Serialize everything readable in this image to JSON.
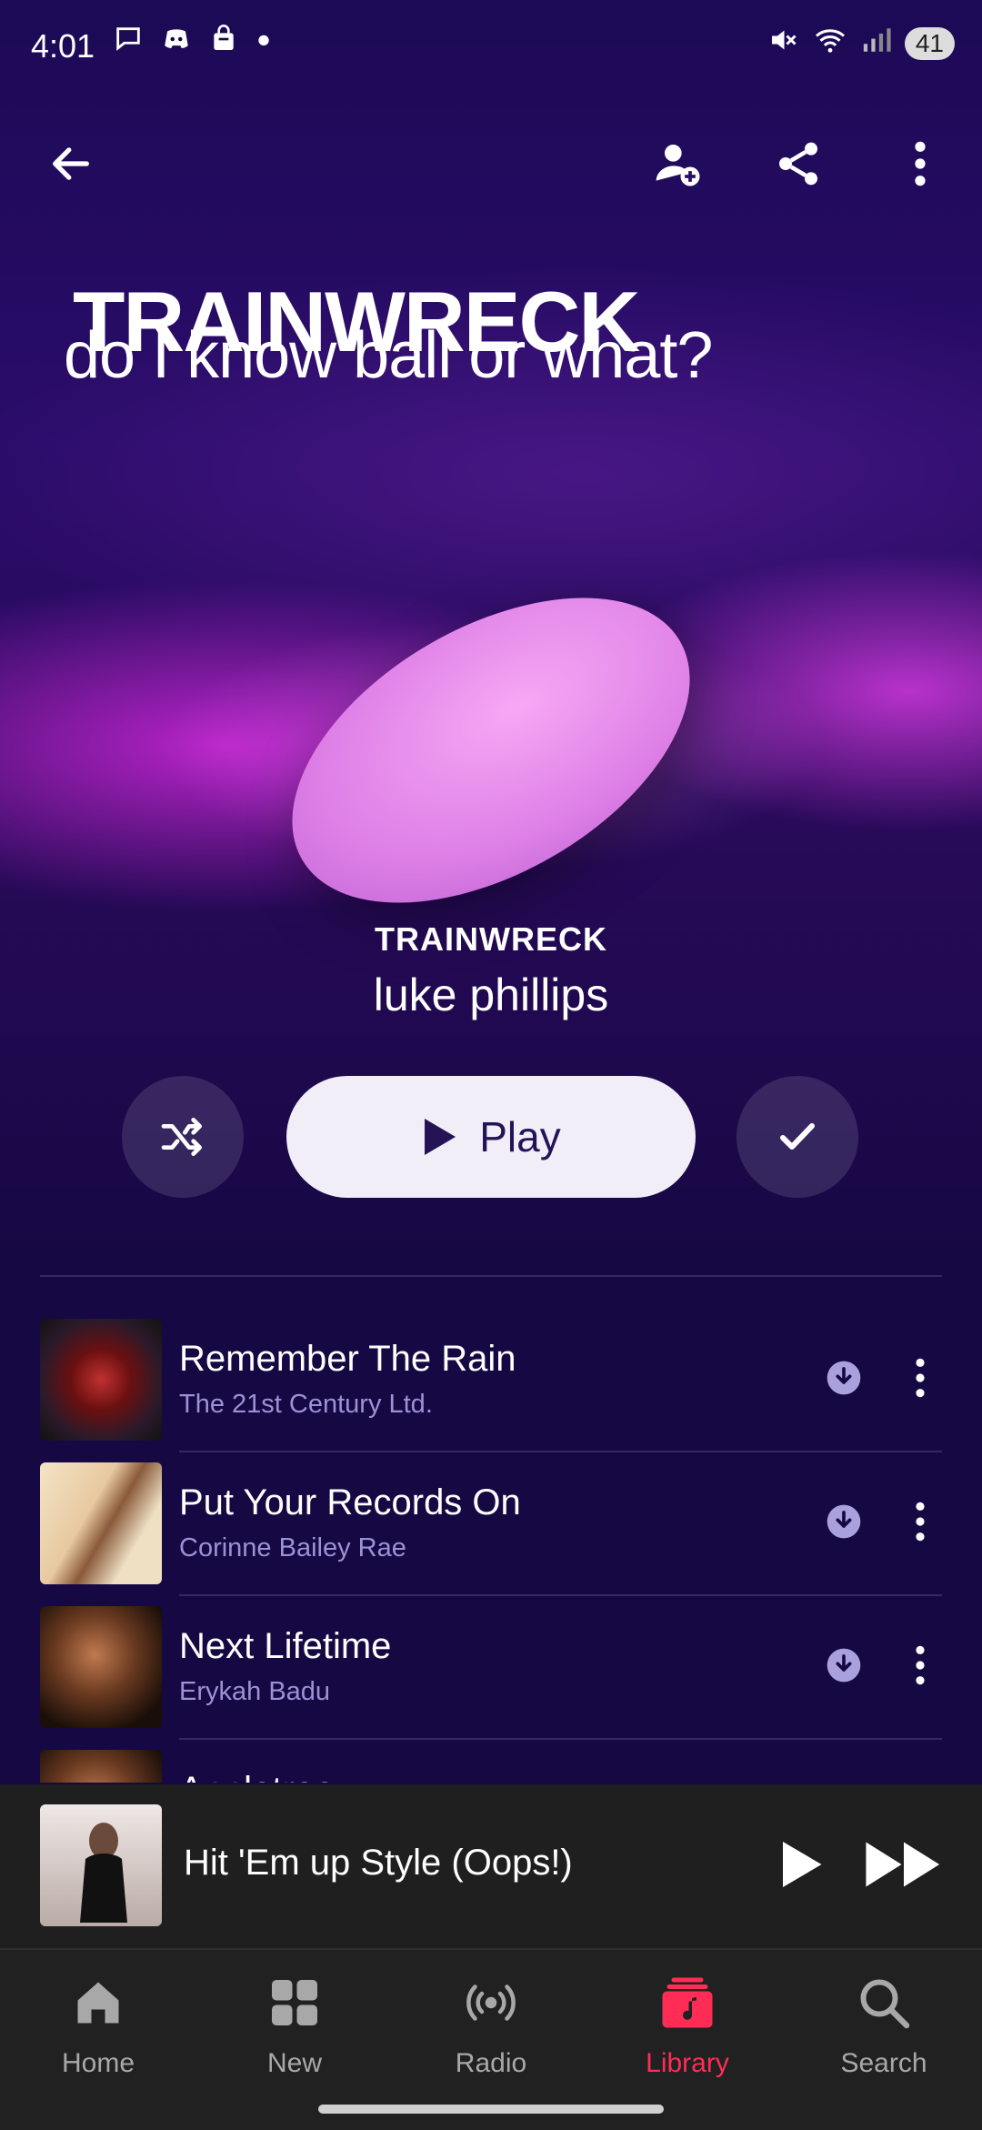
{
  "status_bar": {
    "time": "4:01",
    "battery": "41",
    "left_icons": [
      "chat-icon",
      "discord-icon",
      "shopping-bag-icon",
      "dot-icon"
    ],
    "right_icons": [
      "mute-icon",
      "wifi-icon",
      "signal-icon"
    ]
  },
  "header": {
    "back_icon": "arrow-left-icon",
    "actions": [
      "add-user-icon",
      "share-icon",
      "more-vertical-icon"
    ],
    "title": "TRAINWRECK",
    "subtitle": "do I know ball or what?"
  },
  "album": {
    "title": "TRAINWRECK",
    "artist": "luke phillips"
  },
  "controls": {
    "shuffle_icon": "shuffle-icon",
    "play_label": "Play",
    "added_icon": "checkmark-icon"
  },
  "tracks": [
    {
      "title": "Remember The Rain",
      "artist": "The 21st Century Ltd."
    },
    {
      "title": "Put Your Records On",
      "artist": "Corinne Bailey Rae"
    },
    {
      "title": "Next Lifetime",
      "artist": "Erykah Badu"
    },
    {
      "title": "Appletree",
      "artist": ""
    }
  ],
  "mini_player": {
    "title": "Hit 'Em up Style (Oops!)"
  },
  "tabs": [
    {
      "label": "Home",
      "icon": "home-icon"
    },
    {
      "label": "New",
      "icon": "grid-icon"
    },
    {
      "label": "Radio",
      "icon": "radio-icon"
    },
    {
      "label": "Library",
      "icon": "music-library-icon"
    },
    {
      "label": "Search",
      "icon": "search-icon"
    }
  ],
  "colors": {
    "accent": "#ff2d55",
    "background": "#160843",
    "secondary_text": "#9b92d6"
  }
}
